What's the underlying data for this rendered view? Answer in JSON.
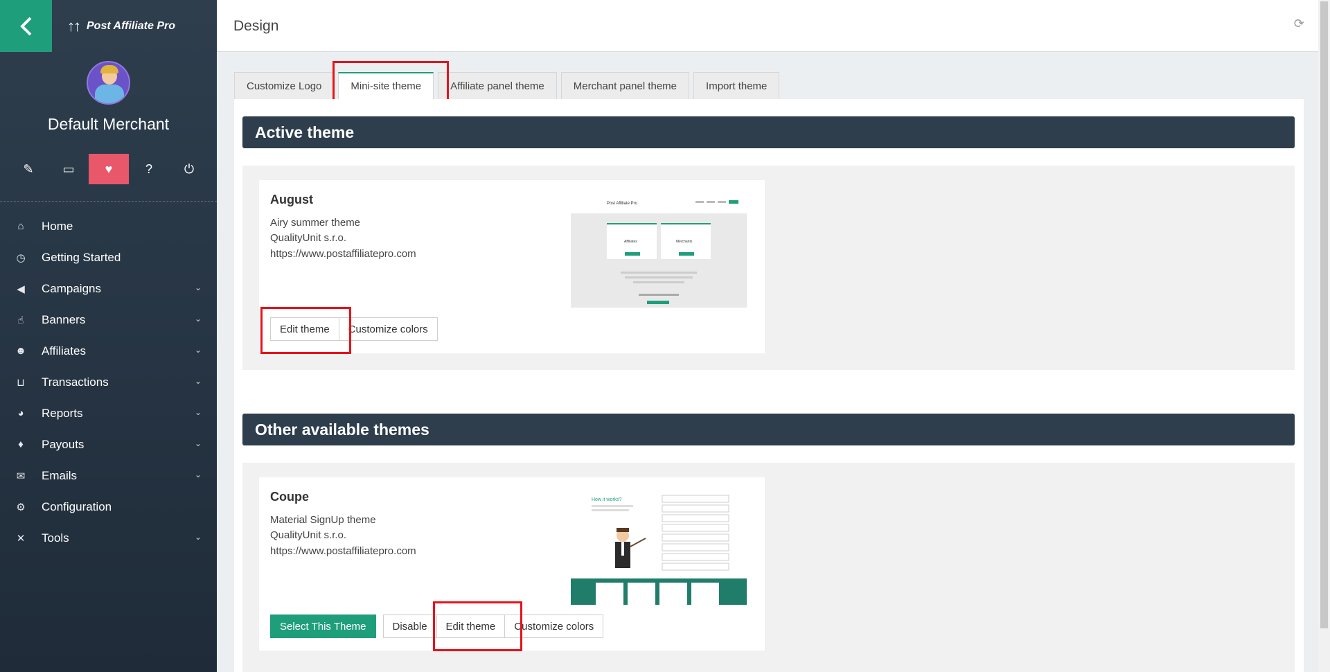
{
  "brand": {
    "name": "Post Affiliate Pro",
    "logo_glyph": "↑↑"
  },
  "user": {
    "name": "Default Merchant"
  },
  "sidebar": {
    "icons": [
      {
        "name": "pencil",
        "glyph": "✎"
      },
      {
        "name": "monitor",
        "glyph": "▭"
      },
      {
        "name": "health",
        "glyph": "♥"
      },
      {
        "name": "help",
        "glyph": "?"
      },
      {
        "name": "power",
        "glyph": "⏻"
      }
    ],
    "items": [
      {
        "label": "Home",
        "icon": "home-icon",
        "glyph": "⌂",
        "expandable": false
      },
      {
        "label": "Getting Started",
        "icon": "stopwatch-icon",
        "glyph": "◷",
        "expandable": false
      },
      {
        "label": "Campaigns",
        "icon": "megaphone-icon",
        "glyph": "◀",
        "expandable": true
      },
      {
        "label": "Banners",
        "icon": "hand-pointer-icon",
        "glyph": "☝",
        "expandable": true
      },
      {
        "label": "Affiliates",
        "icon": "users-icon",
        "glyph": "☻",
        "expandable": true
      },
      {
        "label": "Transactions",
        "icon": "basket-icon",
        "glyph": "⊔",
        "expandable": true
      },
      {
        "label": "Reports",
        "icon": "pie-chart-icon",
        "glyph": "◕",
        "expandable": true
      },
      {
        "label": "Payouts",
        "icon": "money-bag-icon",
        "glyph": "♦",
        "expandable": true
      },
      {
        "label": "Emails",
        "icon": "envelope-icon",
        "glyph": "✉",
        "expandable": true
      },
      {
        "label": "Configuration",
        "icon": "gear-icon",
        "glyph": "⚙",
        "expandable": false
      },
      {
        "label": "Tools",
        "icon": "wrench-icon",
        "glyph": "✕",
        "expandable": true
      }
    ]
  },
  "header": {
    "title": "Design"
  },
  "tabs": [
    {
      "label": "Customize Logo",
      "active": false
    },
    {
      "label": "Mini-site theme",
      "active": true
    },
    {
      "label": "Affiliate panel theme",
      "active": false
    },
    {
      "label": "Merchant panel theme",
      "active": false
    },
    {
      "label": "Import theme",
      "active": false
    }
  ],
  "active_theme": {
    "heading": "Active theme",
    "name": "August",
    "description": "Airy summer theme",
    "author": "QualityUnit s.r.o.",
    "url": "https://www.postaffiliatepro.com",
    "buttons": {
      "edit": "Edit theme",
      "customize": "Customize colors"
    },
    "preview": {
      "brand": "Post Affiliate Pro",
      "left_card": "Affiliates",
      "right_card": "Merchants"
    }
  },
  "other_themes": {
    "heading": "Other available themes",
    "items": [
      {
        "name": "Coupe",
        "description": "Material SignUp theme",
        "author": "QualityUnit s.r.o.",
        "url": "https://www.postaffiliatepro.com",
        "buttons": {
          "select": "Select This Theme",
          "disable": "Disable",
          "edit": "Edit theme",
          "customize": "Customize colors"
        },
        "preview": {
          "heading": "How it works?"
        }
      }
    ]
  },
  "colors": {
    "accent": "#1f9e7c",
    "sidebar": "#2e3e4d",
    "active_icon": "#e8576a",
    "highlight": "#e8121b"
  }
}
